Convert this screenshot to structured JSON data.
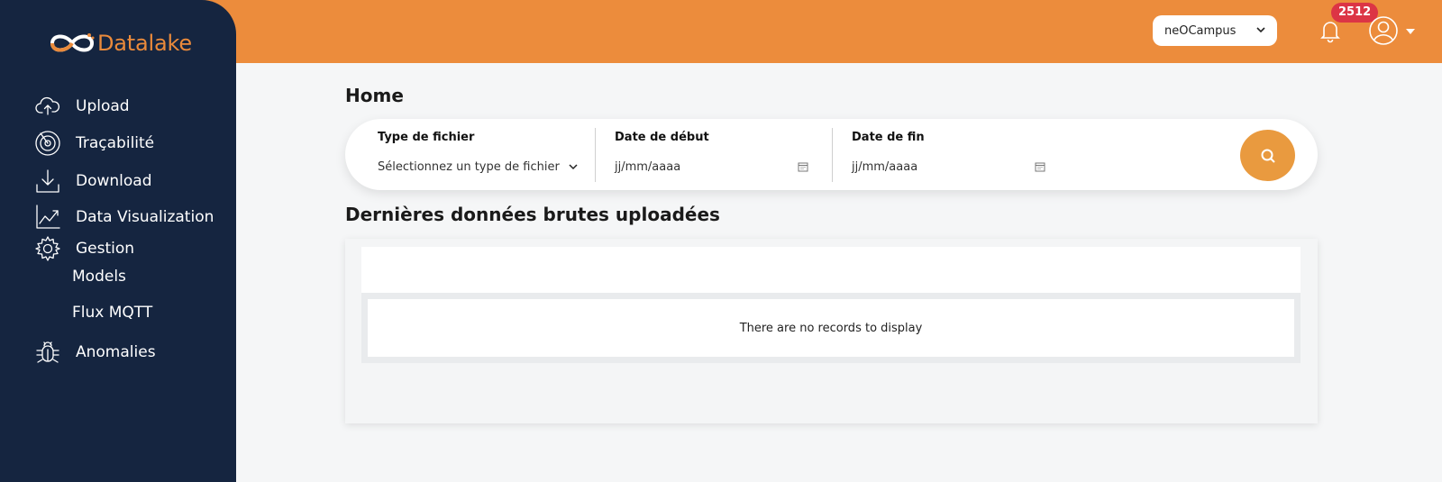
{
  "header": {
    "campus": "neOCampus",
    "notifications_count": "2512",
    "colors": {
      "header_bg": "#ec8c3c",
      "sidebar_bg": "#152540",
      "badge": "#dc3545",
      "accent": "#e99a3f"
    }
  },
  "sidebar": {
    "logo": "Datalake",
    "items": [
      {
        "label": "Upload",
        "icon": "cloud-upload-icon"
      },
      {
        "label": "Traçabilité",
        "icon": "radar-icon"
      },
      {
        "label": "Download",
        "icon": "download-icon"
      },
      {
        "label": "Data Visualization",
        "icon": "chart-icon"
      },
      {
        "label": "Gestion",
        "icon": "gear-icon"
      },
      {
        "label": "Anomalies",
        "icon": "bug-icon"
      }
    ],
    "sub_items": [
      {
        "label": "Models"
      },
      {
        "label": "Flux MQTT"
      }
    ]
  },
  "main": {
    "title": "Home",
    "filters": {
      "file_type": {
        "label": "Type de fichier",
        "value": "Sélectionnez un type de fichier"
      },
      "start_date": {
        "label": "Date de début",
        "value": "jj/mm/aaaa"
      },
      "end_date": {
        "label": "Date de fin",
        "value": "jj/mm/aaaa"
      }
    },
    "section_title": "Dernières données brutes uploadées",
    "table": {
      "empty_message": "There are no records to display"
    }
  }
}
